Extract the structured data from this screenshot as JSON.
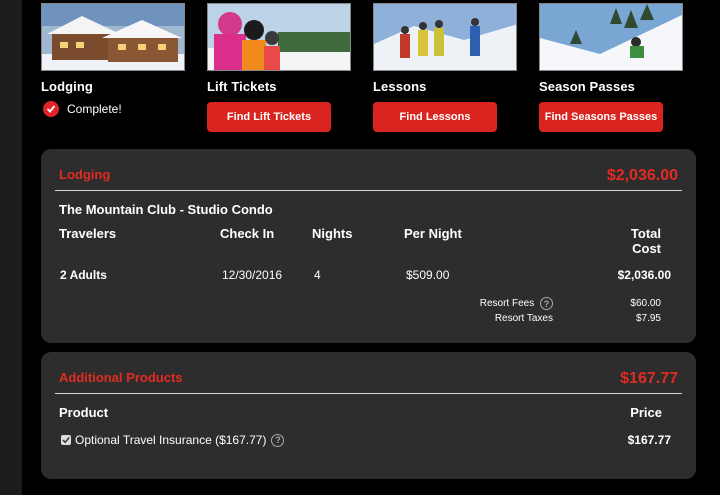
{
  "tiles": [
    {
      "title": "Lodging",
      "status": "Complete!"
    },
    {
      "title": "Lift Tickets",
      "button": "Find Lift Tickets"
    },
    {
      "title": "Lessons",
      "button": "Find Lessons"
    },
    {
      "title": "Season Passes",
      "button": "Find Seasons Passes"
    }
  ],
  "lodging": {
    "label": "Lodging",
    "total": "$2,036.00",
    "property": "The Mountain Club - Studio Condo",
    "columns": {
      "travelers": "Travelers",
      "check_in": "Check In",
      "nights": "Nights",
      "per_night": "Per Night",
      "total_cost_1": "Total",
      "total_cost_2": "Cost"
    },
    "row": {
      "travelers": "2 Adults",
      "check_in": "12/30/2016",
      "nights": "4",
      "per_night": "$509.00",
      "total_cost": "$2,036.00"
    },
    "fees": [
      {
        "label": "Resort Fees",
        "amount": "$60.00",
        "help": true
      },
      {
        "label": "Resort Taxes",
        "amount": "$7.95",
        "help": false
      }
    ]
  },
  "additional": {
    "label": "Additional Products",
    "total": "$167.77",
    "columns": {
      "product": "Product",
      "price": "Price"
    },
    "items": [
      {
        "name": "Optional Travel Insurance ($167.77)",
        "price": "$167.77",
        "checked": true
      }
    ]
  },
  "colors": {
    "accent": "#e32b22",
    "panel": "#2d2d2d",
    "button": "#d9241f"
  }
}
